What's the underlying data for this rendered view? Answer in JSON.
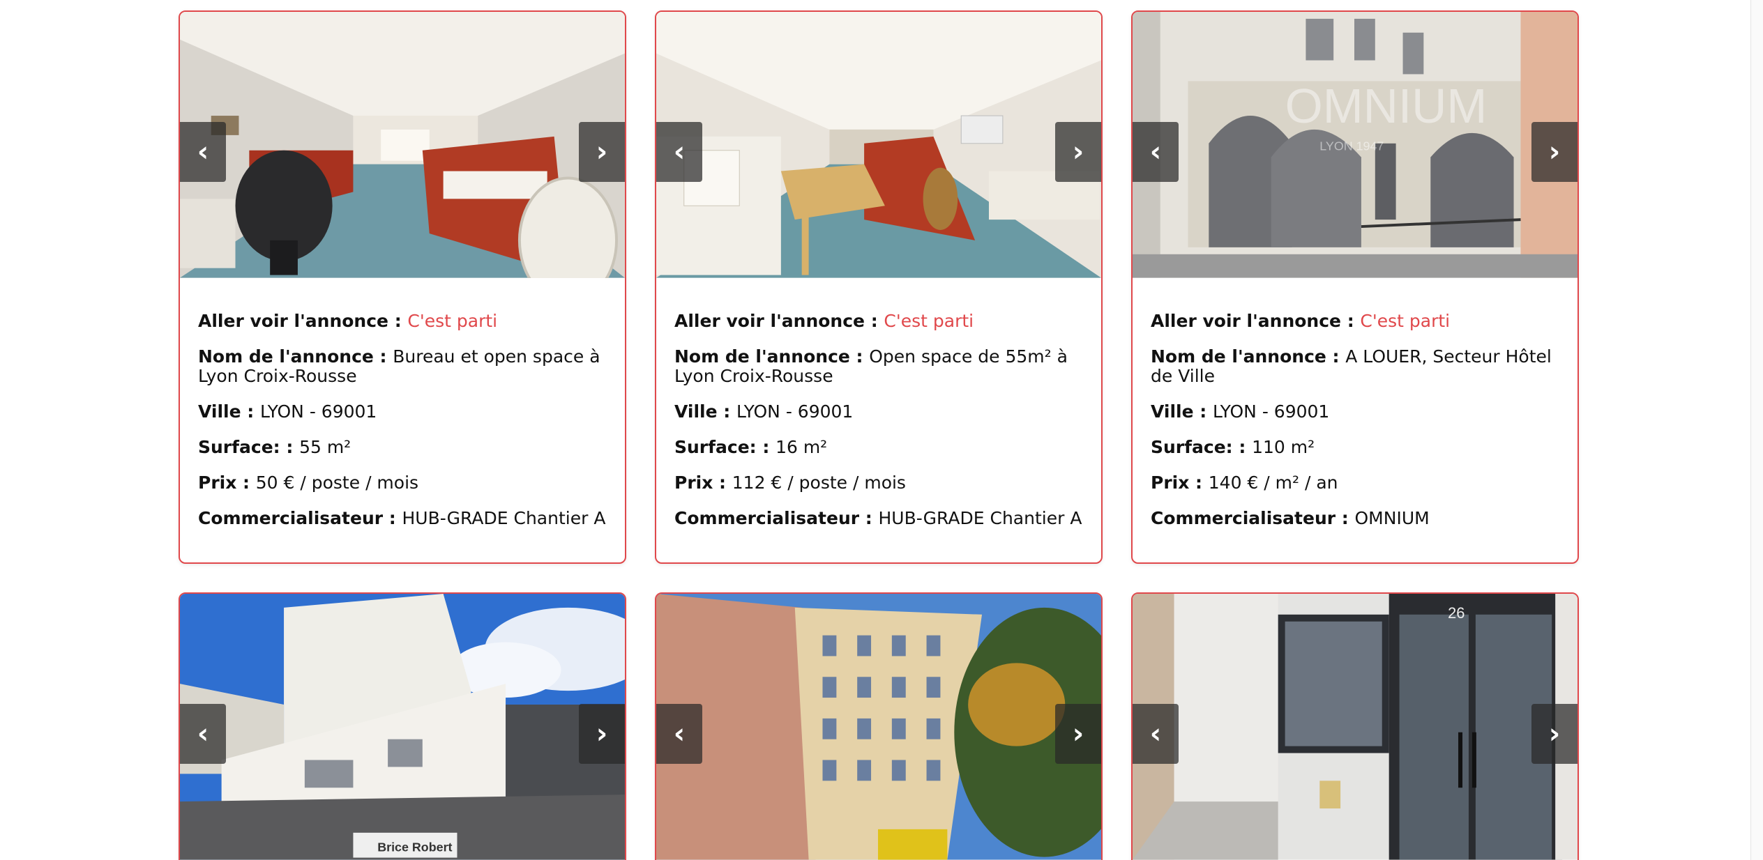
{
  "nav": {
    "prev": "‹",
    "next": "›"
  },
  "labels": {
    "link": "Aller voir l'annonce :",
    "name": "Nom de l'annonce :",
    "city": "Ville :",
    "surface": "Surface: :",
    "price": "Prix :",
    "agent": "Commercialisateur :"
  },
  "accent_color": "#e0484b",
  "listings": [
    {
      "link_text": "C'est parti",
      "name": "Bureau et open space à Lyon Croix-Rousse",
      "city": "LYON - 69001",
      "surface": "55 m²",
      "price": "50 € / poste / mois",
      "agent": "HUB-GRADE Chantier A"
    },
    {
      "link_text": "C'est parti",
      "name": "Open space de 55m² à Lyon Croix-Rousse",
      "city": "LYON - 69001",
      "surface": "16 m²",
      "price": "112 € / poste / mois",
      "agent": "HUB-GRADE Chantier A"
    },
    {
      "link_text": "C'est parti",
      "name": "A LOUER, Secteur Hôtel de Ville",
      "city": "LYON - 69001",
      "surface": "110 m²",
      "price": "140 € / m² / an",
      "agent": "OMNIUM"
    }
  ],
  "photos": {
    "p3_watermark": "OMNIUM",
    "p3_watermark_sub": "LYON 1947",
    "p4_watermark": "Brice Robert",
    "p6_number": "26"
  }
}
